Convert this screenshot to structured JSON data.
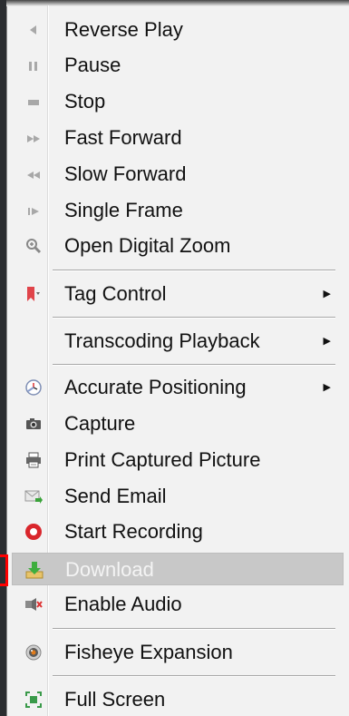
{
  "menu": {
    "items": [
      {
        "label": "Reverse Play",
        "icon": "reverse-play-icon",
        "submenu": false
      },
      {
        "label": "Pause",
        "icon": "pause-icon",
        "submenu": false
      },
      {
        "label": "Stop",
        "icon": "stop-icon",
        "submenu": false
      },
      {
        "label": "Fast Forward",
        "icon": "fast-forward-icon",
        "submenu": false
      },
      {
        "label": "Slow Forward",
        "icon": "slow-forward-icon",
        "submenu": false
      },
      {
        "label": "Single Frame",
        "icon": "single-frame-icon",
        "submenu": false
      },
      {
        "label": "Open Digital Zoom",
        "icon": "zoom-icon",
        "submenu": false
      },
      {
        "label": "Tag Control",
        "icon": "tag-icon",
        "submenu": true
      },
      {
        "label": "Transcoding Playback",
        "icon": "",
        "submenu": true
      },
      {
        "label": "Accurate Positioning",
        "icon": "clock-icon",
        "submenu": true
      },
      {
        "label": "Capture",
        "icon": "camera-icon",
        "submenu": false
      },
      {
        "label": "Print Captured Picture",
        "icon": "printer-icon",
        "submenu": false
      },
      {
        "label": "Send Email",
        "icon": "email-icon",
        "submenu": false
      },
      {
        "label": "Start Recording",
        "icon": "record-icon",
        "submenu": false
      },
      {
        "label": "Download",
        "icon": "download-icon",
        "submenu": false,
        "highlighted": true
      },
      {
        "label": "Enable Audio",
        "icon": "audio-icon",
        "submenu": false
      },
      {
        "label": "Fisheye Expansion",
        "icon": "fisheye-icon",
        "submenu": false
      },
      {
        "label": "Full Screen",
        "icon": "fullscreen-icon",
        "submenu": false
      }
    ],
    "submenu_arrow": "▶"
  },
  "colors": {
    "menu_bg": "#f2f2f2",
    "highlight_bg": "#c8c8c8",
    "highlight_text": "#f4f4f4",
    "text": "#111111",
    "annotation": "#ff0000"
  }
}
